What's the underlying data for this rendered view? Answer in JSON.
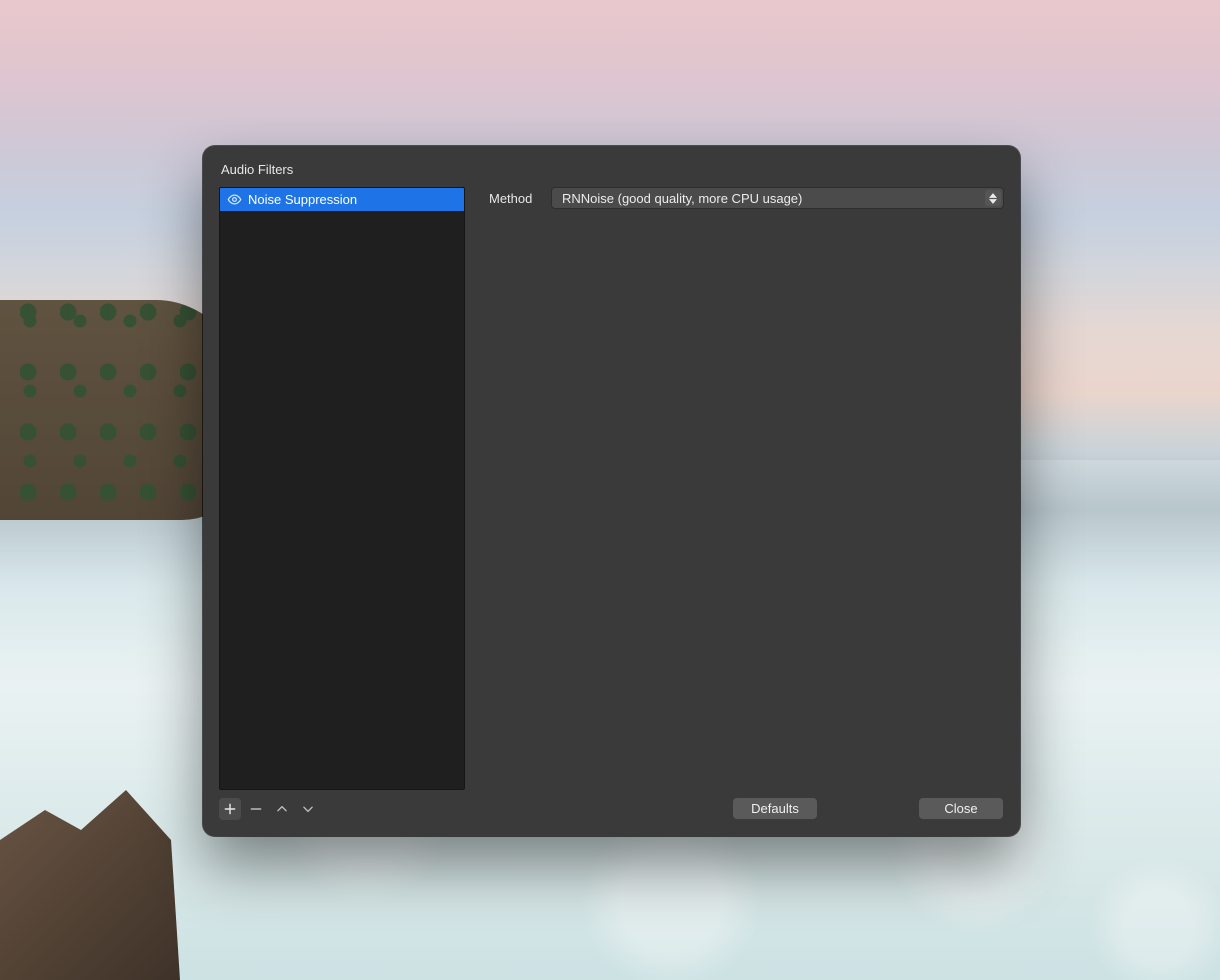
{
  "dialog": {
    "title": "Audio Filters",
    "filters": [
      {
        "name": "Noise Suppression",
        "visible": true,
        "selected": true
      }
    ],
    "toolbar": {
      "add": "+",
      "remove": "−",
      "move_up": "▲",
      "move_down": "▼"
    },
    "form": {
      "method_label": "Method",
      "method_value": "RNNoise (good quality, more CPU usage)"
    },
    "buttons": {
      "defaults": "Defaults",
      "close": "Close"
    }
  },
  "colors": {
    "dialog_bg": "#3a3a3a",
    "list_bg": "#1f1f1f",
    "selection": "#1e74e6",
    "control_bg": "#4b4b4b"
  }
}
